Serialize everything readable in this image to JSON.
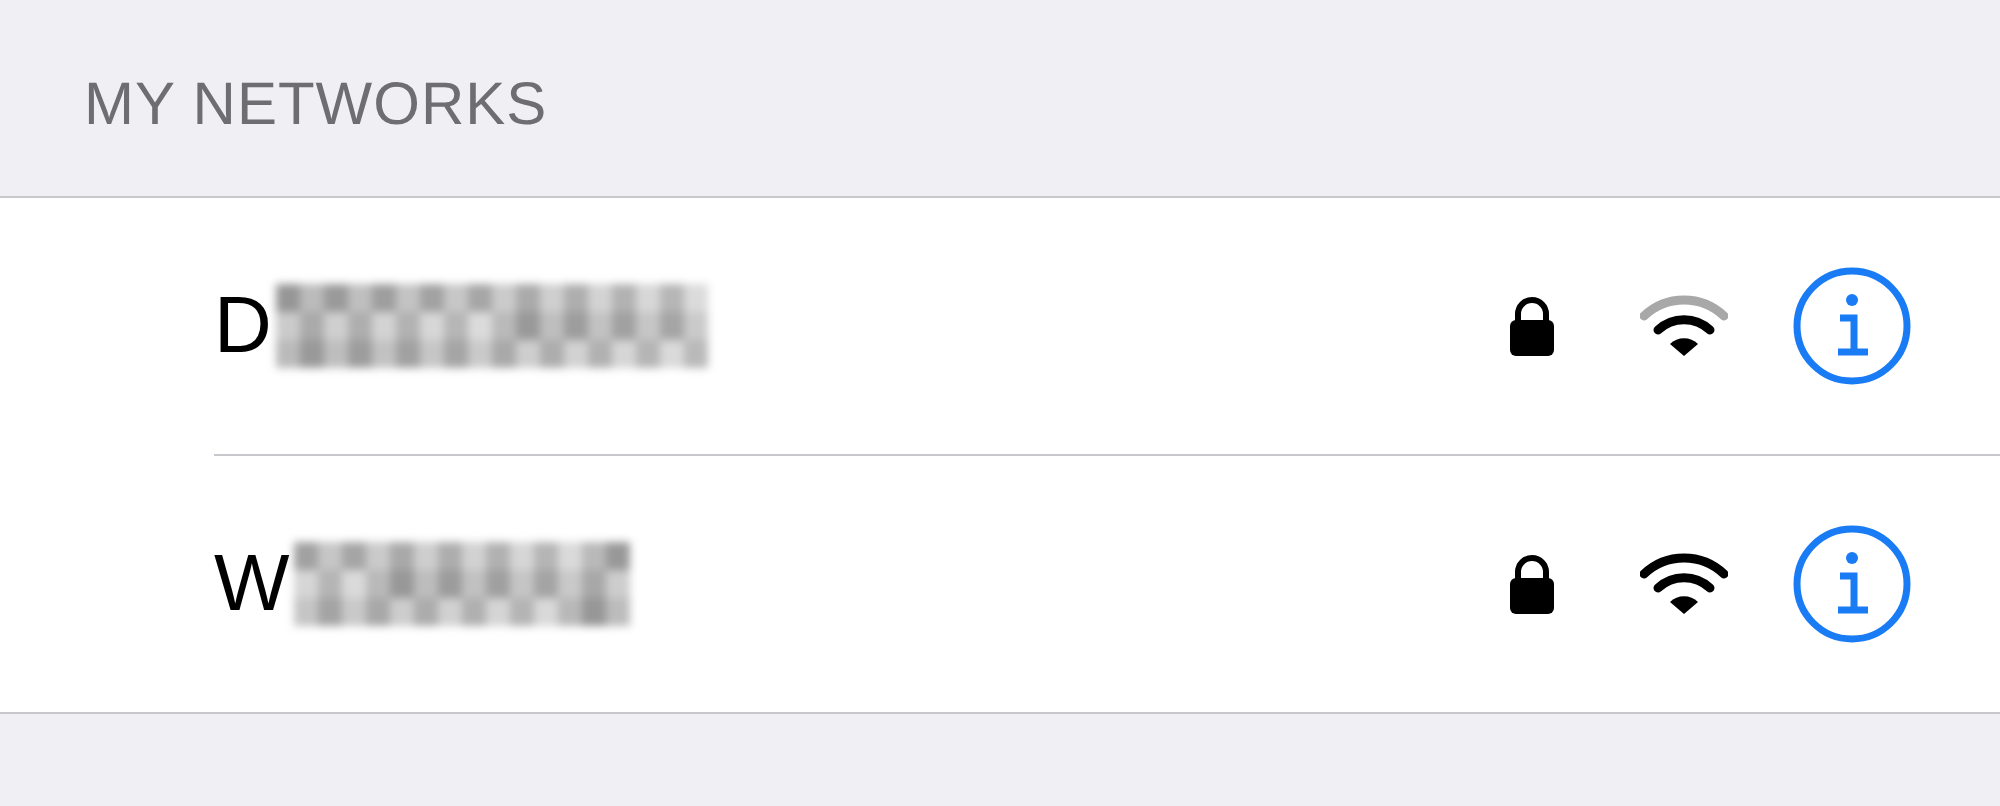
{
  "section_header": "MY NETWORKS",
  "networks": [
    {
      "name": "D",
      "secured": true,
      "signal_strong": false
    },
    {
      "name": "W",
      "secured": true,
      "signal_strong": true
    }
  ]
}
